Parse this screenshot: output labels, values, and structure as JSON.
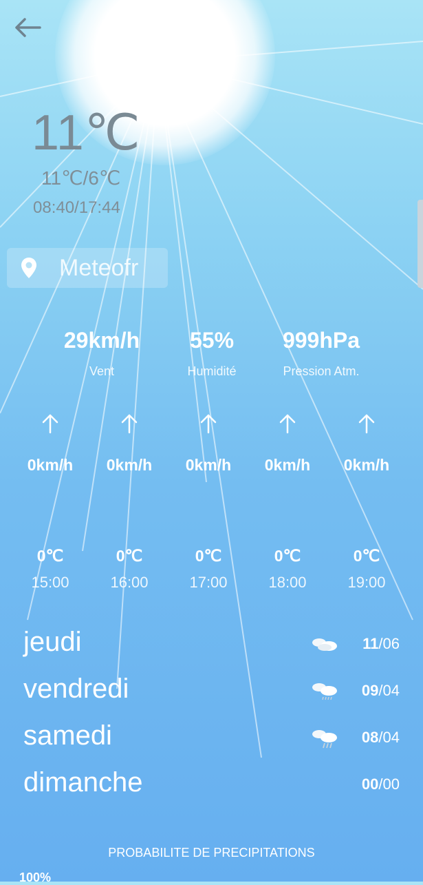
{
  "current": {
    "temperature": "11℃",
    "range": "11℃/6℃",
    "sun_times": "08:40/17:44"
  },
  "location": {
    "name": "Meteofr",
    "icon": "location-pin-icon"
  },
  "stats": [
    {
      "value": "29km/h",
      "label": "Vent"
    },
    {
      "value": "55%",
      "label": "Humidité"
    },
    {
      "value": "999hPa",
      "label": "Pression Atm."
    }
  ],
  "hourly": [
    {
      "wind": "0km/h",
      "temp": "0℃",
      "hour": "15:00"
    },
    {
      "wind": "0km/h",
      "temp": "0℃",
      "hour": "16:00"
    },
    {
      "wind": "0km/h",
      "temp": "0℃",
      "hour": "17:00"
    },
    {
      "wind": "0km/h",
      "temp": "0℃",
      "hour": "18:00"
    },
    {
      "wind": "0km/h",
      "temp": "0℃",
      "hour": "19:00"
    }
  ],
  "daily": [
    {
      "day": "jeudi",
      "max": "11",
      "min": "06",
      "icon": "cloudy-icon"
    },
    {
      "day": "vendredi",
      "max": "09",
      "min": "04",
      "icon": "cloud-drizzle-icon"
    },
    {
      "day": "samedi",
      "max": "08",
      "min": "04",
      "icon": "cloud-rain-icon"
    },
    {
      "day": "dimanche",
      "max": "00",
      "min": "00",
      "icon": ""
    }
  ],
  "precipitation": {
    "title": "PROBABILITE DE PRECIPITATIONS",
    "value": "100%"
  },
  "colors": {
    "text_gray": "#7a8a94",
    "sky_top": "#a9e4f6",
    "sky_bottom": "#66aff0"
  }
}
